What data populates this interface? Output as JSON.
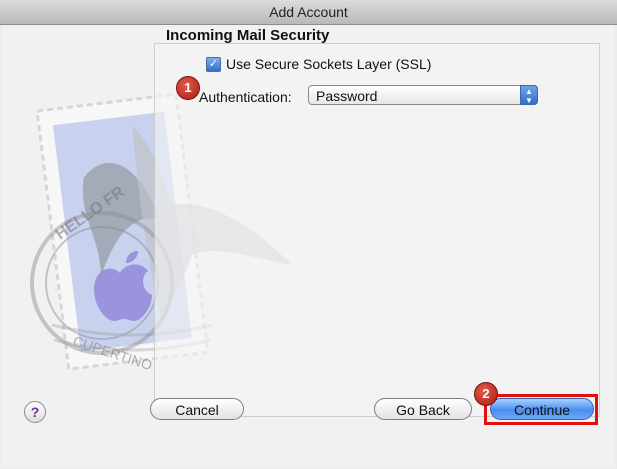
{
  "window": {
    "title": "Add Account"
  },
  "section": {
    "title": "Incoming Mail Security"
  },
  "ssl": {
    "label": "Use Secure Sockets Layer (SSL)",
    "checked": true
  },
  "authentication": {
    "label": "Authentication:",
    "value": "Password"
  },
  "stamp": {
    "top_text": "HELLO FR",
    "bottom_text": "CUPERTINO"
  },
  "badges": [
    "1",
    "2"
  ],
  "buttons": {
    "help": "?",
    "cancel": "Cancel",
    "go_back": "Go Back",
    "continue": "Continue"
  },
  "colors": {
    "accent": "#3a7be0",
    "highlight": "#e01010",
    "badge": "#c0281c"
  }
}
